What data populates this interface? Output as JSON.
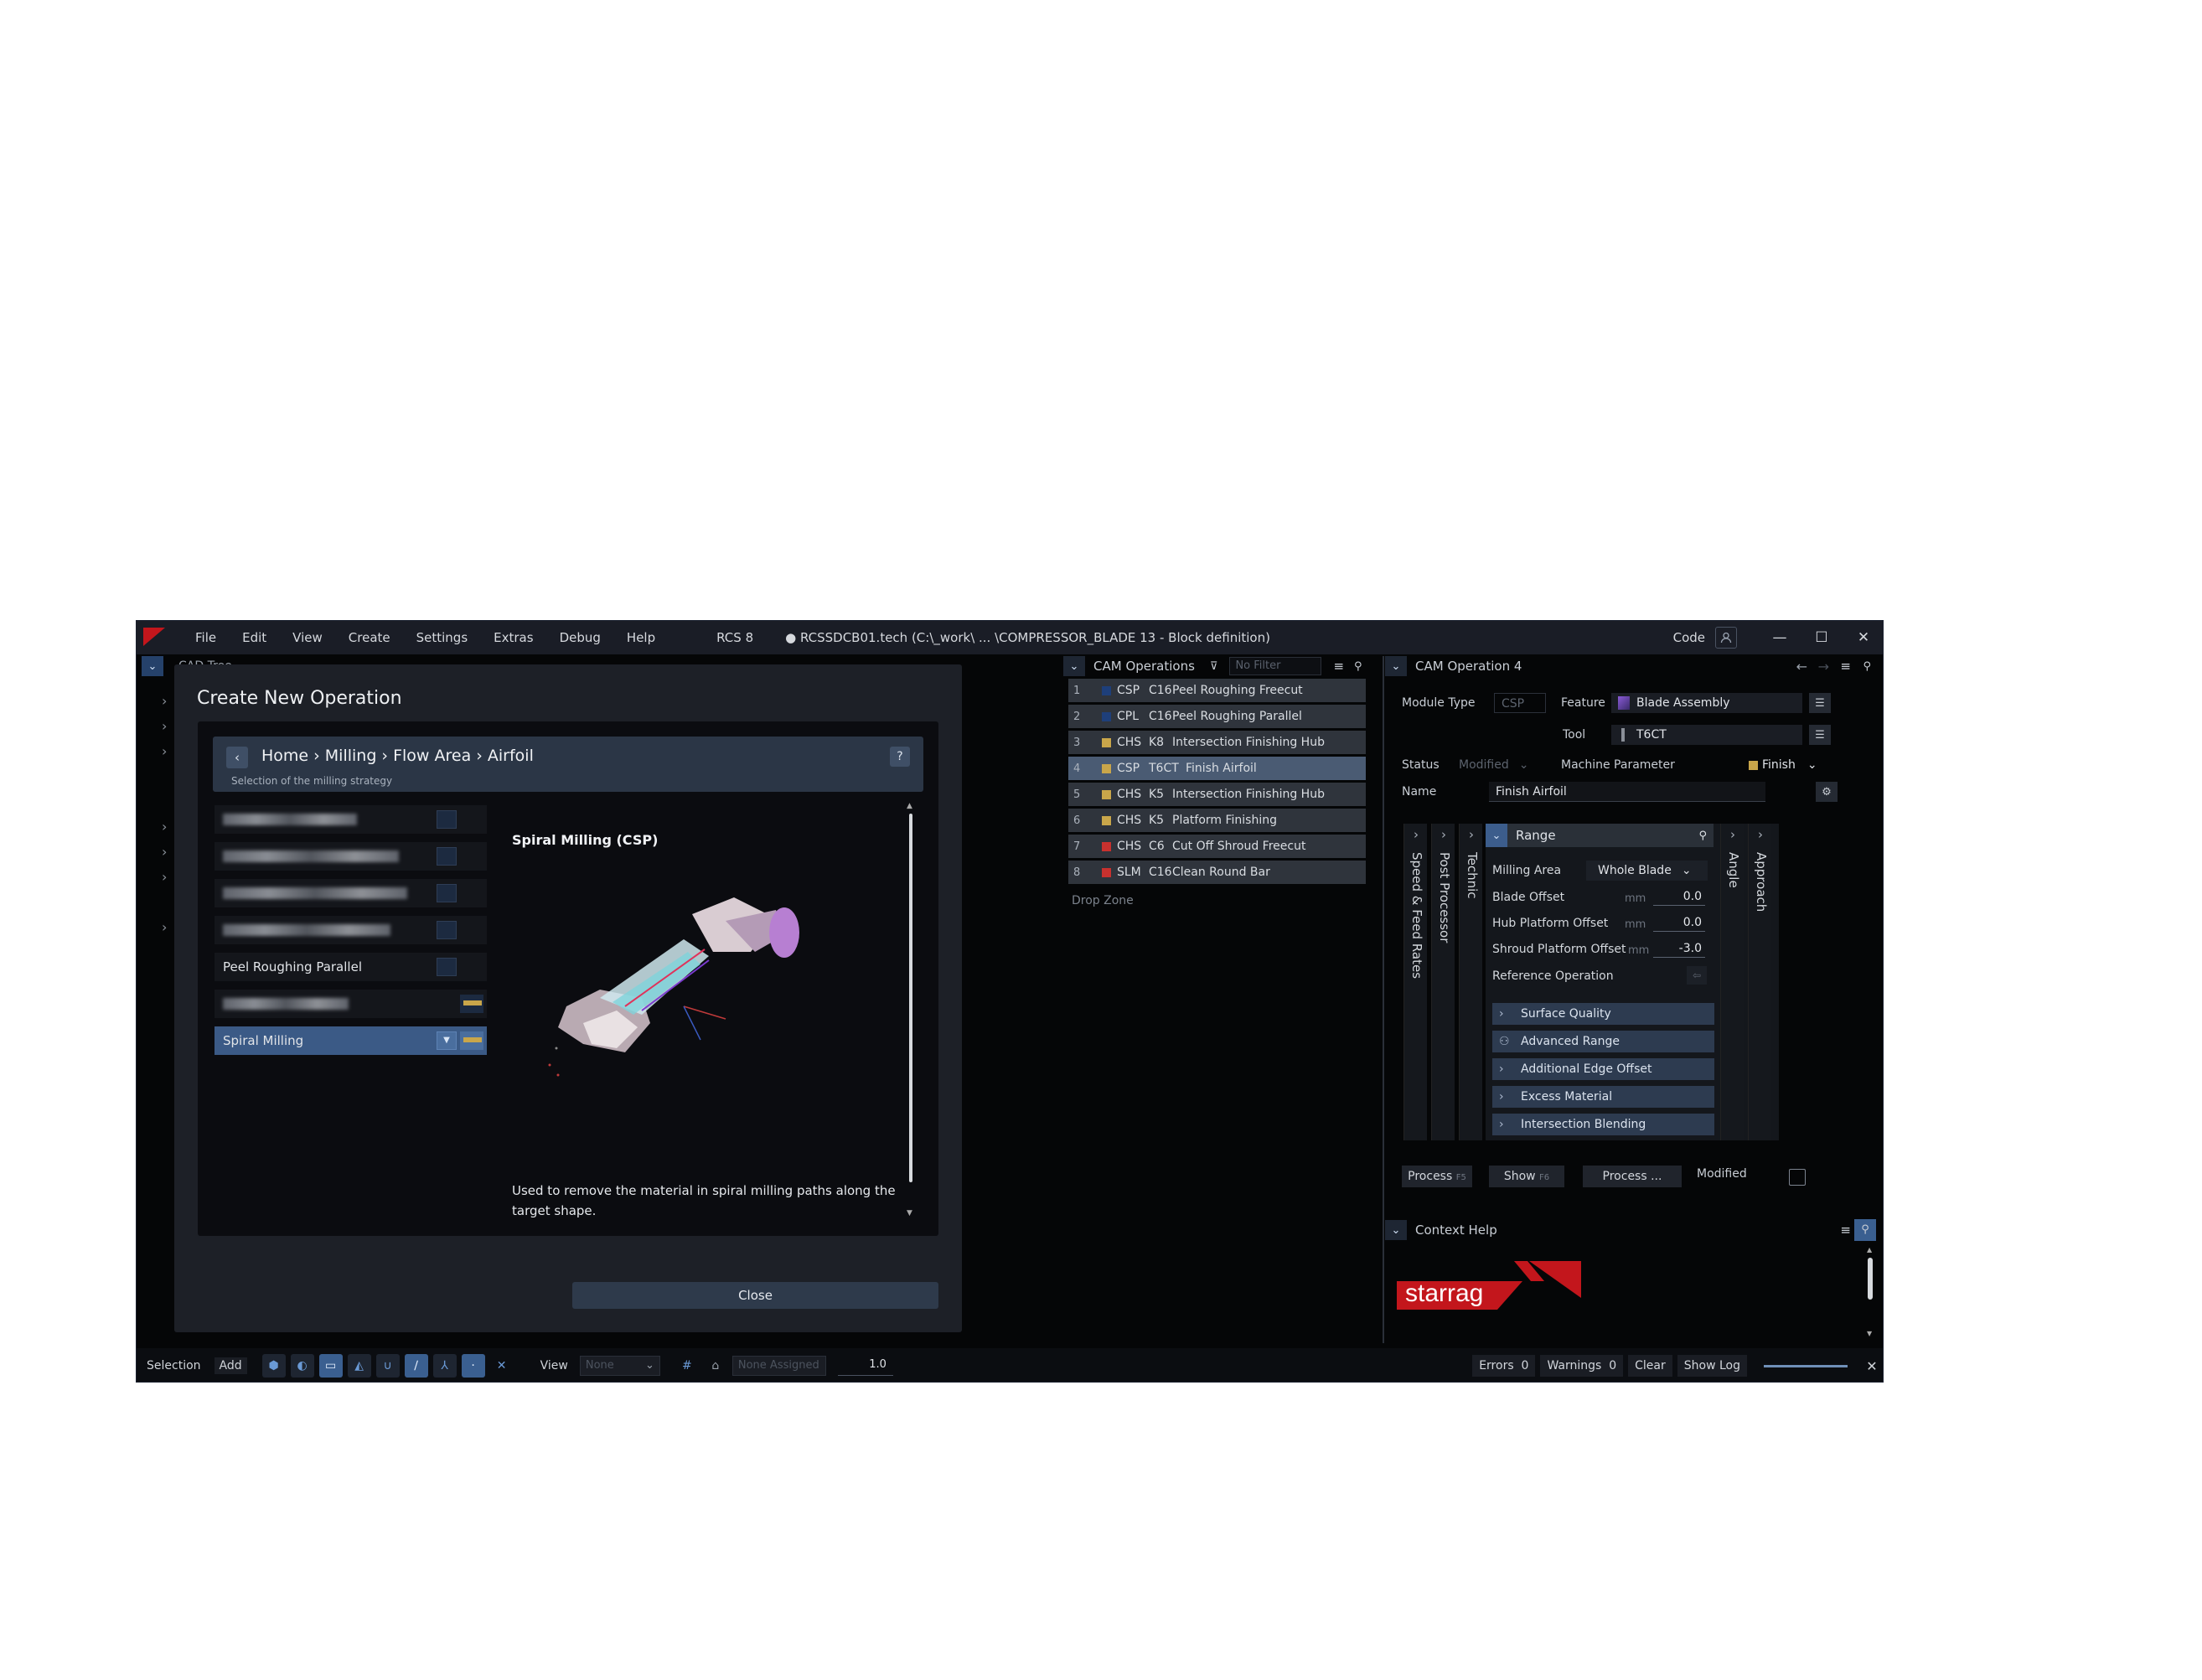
{
  "window": {
    "menu": [
      "File",
      "Edit",
      "View",
      "Create",
      "Settings",
      "Extras",
      "Debug",
      "Help"
    ],
    "app_version": "RCS 8",
    "document": "● RCSSDCB01.tech (C:\\_work\\ ... \\COMPRESSOR_BLADE 13 - Block definition)",
    "code_label": "Code",
    "minimize": "—",
    "maximize": "☐",
    "close": "✕"
  },
  "cad_tree": {
    "title": "CAD Tree"
  },
  "dialog": {
    "title": "Create New Operation",
    "breadcrumb": "Home › Milling › Flow Area › Airfoil",
    "breadcrumb_sub": "Selection of the milling strategy",
    "help": "?",
    "items": [
      {
        "label": "",
        "blurred": true
      },
      {
        "label": "",
        "blurred": true
      },
      {
        "label": "",
        "blurred": true
      },
      {
        "label": "",
        "blurred": true
      },
      {
        "label": "Peel Roughing Parallel",
        "blurred": false
      },
      {
        "label": "",
        "blurred": true
      },
      {
        "label": "Spiral Milling",
        "blurred": false,
        "selected": true
      }
    ],
    "detail_title": "Spiral Milling (CSP)",
    "detail_description": "Used to remove the material in spiral milling paths along the target shape.",
    "close_label": "Close"
  },
  "cam_operations": {
    "title": "CAM Operations",
    "filter_placeholder": "No Filter",
    "rows": [
      {
        "num": "1",
        "color": "#1e3f7a",
        "code": "CSP",
        "tool": "C16",
        "name": "Peel Roughing Freecut"
      },
      {
        "num": "2",
        "color": "#1e3f7a",
        "code": "CPL",
        "tool": "C16",
        "name": "Peel Roughing Parallel"
      },
      {
        "num": "3",
        "color": "#c9a64a",
        "code": "CHS",
        "tool": "K8",
        "name": "Intersection Finishing Hub"
      },
      {
        "num": "4",
        "color": "#c9a64a",
        "code": "CSP",
        "tool": "T6CT",
        "name": "Finish Airfoil",
        "selected": true
      },
      {
        "num": "5",
        "color": "#c9a64a",
        "code": "CHS",
        "tool": "K5",
        "name": "Intersection Finishing Hub"
      },
      {
        "num": "6",
        "color": "#c9a64a",
        "code": "CHS",
        "tool": "K5",
        "name": "Platform Finishing"
      },
      {
        "num": "7",
        "color": "#c8312e",
        "code": "CHS",
        "tool": "C6",
        "name": "Cut Off Shroud Freecut"
      },
      {
        "num": "8",
        "color": "#c8312e",
        "code": "SLM",
        "tool": "C16",
        "name": "Clean Round Bar"
      }
    ],
    "drop_zone": "Drop Zone"
  },
  "cam_operation": {
    "title": "CAM Operation 4",
    "module_type_label": "Module Type",
    "module_type_value": "CSP",
    "feature_label": "Feature",
    "feature_value": "Blade Assembly",
    "tool_label": "Tool",
    "tool_value": "T6CT",
    "status_label": "Status",
    "status_value": "Modified",
    "machine_param_label": "Machine Parameter",
    "machine_param_value": "Finish",
    "name_label": "Name",
    "name_value": "Finish Airfoil",
    "left_tabs": [
      "Speed & Feed Rates",
      "Post Processor",
      "Technic"
    ],
    "right_tabs": [
      "Angle",
      "Approach"
    ],
    "range": {
      "title": "Range",
      "milling_area_label": "Milling Area",
      "milling_area_value": "Whole Blade",
      "blade_offset_label": "Blade Offset",
      "blade_offset_value": "0.0",
      "hub_offset_label": "Hub Platform Offset",
      "hub_offset_value": "0.0",
      "shroud_offset_label": "Shroud Platform Offset",
      "shroud_offset_value": "-3.0",
      "unit": "mm",
      "reference_label": "Reference Operation",
      "subsections": [
        "Surface Quality",
        "Advanced Range",
        "Additional Edge Offset",
        "Excess Material",
        "Intersection Blending"
      ]
    },
    "process_label": "Process",
    "process_key": "F5",
    "show_label": "Show",
    "show_key": "F6",
    "process_more_label": "Process ...",
    "modified_label": "Modified"
  },
  "context_help": {
    "title": "Context Help",
    "brand": "starrag"
  },
  "statusbar": {
    "selection": "Selection",
    "add": "Add",
    "view_label": "View",
    "view_placeholder": "None",
    "assigned_placeholder": "None Assigned",
    "zoom_value": "1.0",
    "errors_label": "Errors",
    "errors_count": "0",
    "warnings_label": "Warnings",
    "warnings_count": "0",
    "clear": "Clear",
    "show_log": "Show Log"
  }
}
